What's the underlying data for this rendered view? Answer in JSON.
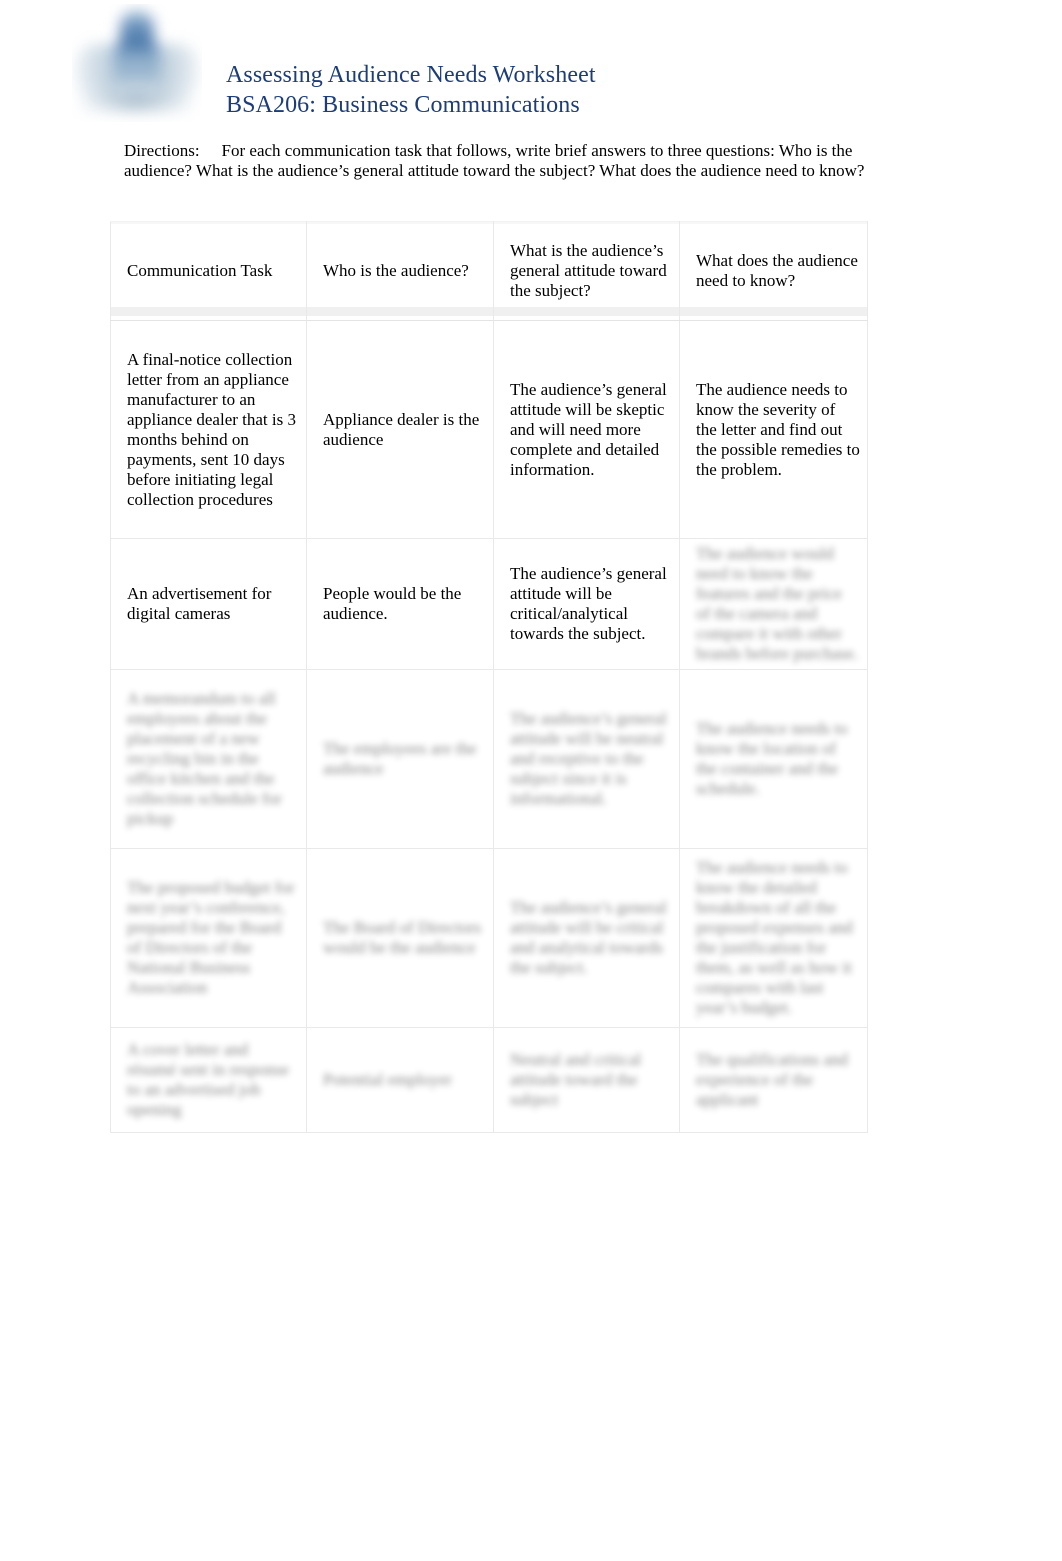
{
  "document": {
    "title_line_1": "Assessing Audience Needs Worksheet",
    "title_line_2": "BSA206: Business Communications",
    "title_color": "#1c3d7a",
    "logo_name": "university-crest-logo"
  },
  "directions": {
    "label": "Directions:",
    "body": "For each communication task that follows, write brief answers to three questions: Who is the audience? What is the audience’s general attitude toward the subject? What does the audience need to know?"
  },
  "table": {
    "headers": [
      "Communication Task",
      "Who is the audience?",
      "What is the audience’s general attitude toward the subject?",
      "What does the audience need to know?"
    ],
    "rows": [
      {
        "redacted": false,
        "task": "A final-notice collection letter from an appliance manufacturer to an appliance dealer that is 3 months behind on payments, sent 10 days before initiating legal collection procedures",
        "who": "Appliance dealer is the audience",
        "attitude": "The audience’s general attitude will be skeptic and will need more complete and detailed information.",
        "need": "The audience needs to know the severity of the letter and find out the possible remedies to the problem."
      },
      {
        "redacted": false,
        "task": "An advertisement for digital cameras",
        "who": "People would be the audience.",
        "attitude": "The audience’s general attitude will be critical/analytical towards the subject.",
        "need": "The audience would need to know the features and the price of the camera and compare it with other brands before purchase.",
        "need_redacted": true
      },
      {
        "redacted": true,
        "task": "A memorandum to all employees about the placement of a new recycling bin in the office kitchen and the collection schedule for pickup",
        "who": "The employees are the audience",
        "attitude": "The audience’s general attitude will be neutral and receptive to the subject since it is informational.",
        "need": "The audience needs to know the location of the container and the schedule."
      },
      {
        "redacted": true,
        "task": "The proposed budget for next year’s conference, prepared for the Board of Directors of the National Business Association",
        "who": "The Board of Directors would be the audience",
        "attitude": "The audience’s general attitude will be critical and analytical towards the subject.",
        "need": "The audience needs to know the detailed breakdown of all the proposed expenses and the justification for them, as well as how it compares with last year’s budget."
      },
      {
        "redacted": true,
        "task": "A cover letter and résumé sent in response to an advertised job opening",
        "who": "Potential employer",
        "attitude": "Neutral and critical attitude toward the subject",
        "need": "The qualifications and experience of the applicant"
      }
    ]
  }
}
